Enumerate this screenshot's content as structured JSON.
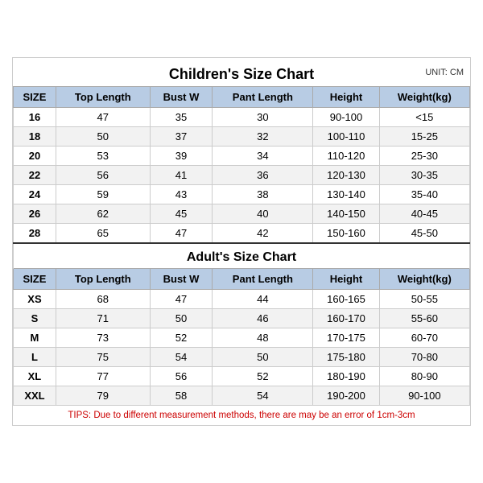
{
  "title": "Children's Size Chart",
  "unit": "UNIT: CM",
  "children": {
    "headers": [
      "SIZE",
      "Top Length",
      "Bust W",
      "Pant Length",
      "Height",
      "Weight(kg)"
    ],
    "rows": [
      [
        "16",
        "47",
        "35",
        "30",
        "90-100",
        "<15"
      ],
      [
        "18",
        "50",
        "37",
        "32",
        "100-110",
        "15-25"
      ],
      [
        "20",
        "53",
        "39",
        "34",
        "110-120",
        "25-30"
      ],
      [
        "22",
        "56",
        "41",
        "36",
        "120-130",
        "30-35"
      ],
      [
        "24",
        "59",
        "43",
        "38",
        "130-140",
        "35-40"
      ],
      [
        "26",
        "62",
        "45",
        "40",
        "140-150",
        "40-45"
      ],
      [
        "28",
        "65",
        "47",
        "42",
        "150-160",
        "45-50"
      ]
    ]
  },
  "adult": {
    "title": "Adult's Size Chart",
    "headers": [
      "SIZE",
      "Top Length",
      "Bust W",
      "Pant Length",
      "Height",
      "Weight(kg)"
    ],
    "rows": [
      [
        "XS",
        "68",
        "47",
        "44",
        "160-165",
        "50-55"
      ],
      [
        "S",
        "71",
        "50",
        "46",
        "160-170",
        "55-60"
      ],
      [
        "M",
        "73",
        "52",
        "48",
        "170-175",
        "60-70"
      ],
      [
        "L",
        "75",
        "54",
        "50",
        "175-180",
        "70-80"
      ],
      [
        "XL",
        "77",
        "56",
        "52",
        "180-190",
        "80-90"
      ],
      [
        "XXL",
        "79",
        "58",
        "54",
        "190-200",
        "90-100"
      ]
    ]
  },
  "tips": "TIPS: Due to different measurement methods, there are may be an error of 1cm-3cm"
}
